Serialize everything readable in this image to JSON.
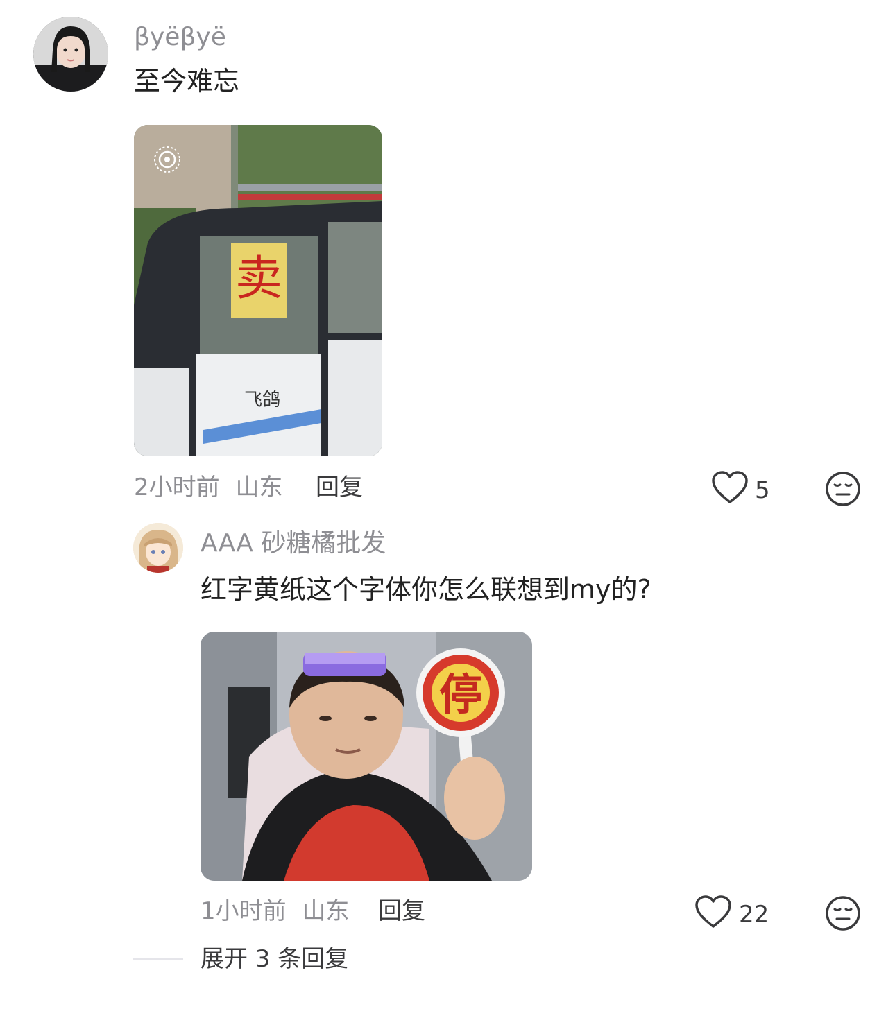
{
  "comments": [
    {
      "username": "βyëβyë",
      "text": "至今难忘",
      "time": "2小时前",
      "location": "山东",
      "reply_label": "回复",
      "likes": "5",
      "avatar_icon": "user-avatar-photo",
      "image_icon": "photo-car-with-sign"
    },
    {
      "username": "AAA 砂糖橘批发",
      "text": "红字黄纸这个字体你怎么联想到my的?",
      "time": "1小时前",
      "location": "山东",
      "reply_label": "回复",
      "likes": "22",
      "avatar_icon": "anime-avatar",
      "image_icon": "photo-person-holding-stop-sign",
      "expand_label": "展开 3 条回复"
    }
  ],
  "colors": {
    "secondary_text": "#8e8e93",
    "primary_text": "#222222",
    "icon": "#3a3a3c"
  }
}
